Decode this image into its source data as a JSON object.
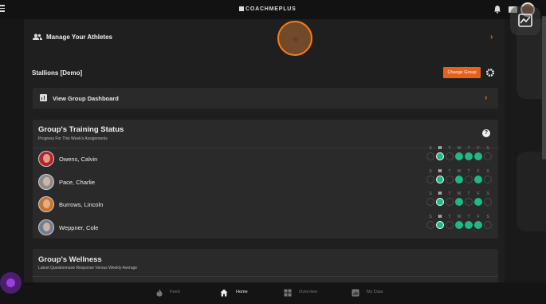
{
  "header": {
    "brand": "COACHMEPLUS"
  },
  "manage_athletes": {
    "label": "Manage Your Athletes"
  },
  "group": {
    "name": "Stallions [Demo]",
    "change_button": "Change Group"
  },
  "dashboard": {
    "label": "View Group Dashboard"
  },
  "training_status": {
    "title": "Group's Training Status",
    "subtitle": "Progress For This Week's Assignments",
    "help_label": "?",
    "days": [
      "S",
      "M",
      "T",
      "W",
      "T",
      "F",
      "S"
    ],
    "today_index": 1,
    "athletes": [
      {
        "name": "Owens, Calvin",
        "completed": [
          false,
          true,
          false,
          true,
          true,
          true,
          false
        ],
        "photo_color": "#b8232a"
      },
      {
        "name": "Pace, Charlie",
        "completed": [
          false,
          true,
          false,
          true,
          false,
          true,
          false
        ],
        "photo_color": "#8d8d8d"
      },
      {
        "name": "Burrows, Lincoln",
        "completed": [
          false,
          true,
          false,
          true,
          false,
          true,
          false
        ],
        "photo_color": "#c8742e"
      },
      {
        "name": "Weppner, Cole",
        "completed": [
          false,
          true,
          false,
          true,
          true,
          true,
          false
        ],
        "photo_color": "#6e7e94"
      }
    ]
  },
  "wellness": {
    "title": "Group's Wellness",
    "subtitle": "Latest Questionnaire Response Versus Weekly Average"
  },
  "bottom_nav": {
    "items": [
      {
        "label": "Feed",
        "icon": "flame-icon",
        "active": false
      },
      {
        "label": "Home",
        "icon": "home-icon",
        "active": true
      },
      {
        "label": "Overview",
        "icon": "grid-icon",
        "active": false
      },
      {
        "label": "My Data",
        "icon": "chart-icon",
        "active": false
      }
    ]
  },
  "colors": {
    "accent": "#e8611a",
    "complete": "#1fb886",
    "background": "#1f1f1f",
    "card": "#2a2a2a"
  }
}
